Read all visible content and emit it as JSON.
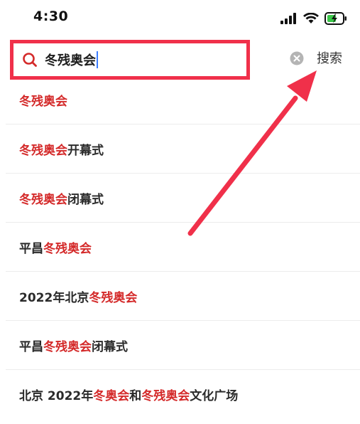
{
  "status_bar": {
    "time": "4:30"
  },
  "search": {
    "query": "冬残奥会",
    "search_label": "搜索"
  },
  "suggestions": [
    {
      "parts": [
        {
          "text": "冬残奥会",
          "hl": true
        }
      ]
    },
    {
      "parts": [
        {
          "text": "冬残奥会",
          "hl": true
        },
        {
          "text": "开幕式",
          "hl": false
        }
      ]
    },
    {
      "parts": [
        {
          "text": "冬残奥会",
          "hl": true
        },
        {
          "text": "闭幕式",
          "hl": false
        }
      ]
    },
    {
      "parts": [
        {
          "text": "平昌",
          "hl": false
        },
        {
          "text": "冬残奥会",
          "hl": true
        }
      ]
    },
    {
      "parts": [
        {
          "text": "2022年北京",
          "hl": false
        },
        {
          "text": "冬残奥会",
          "hl": true
        }
      ]
    },
    {
      "parts": [
        {
          "text": "平昌",
          "hl": false
        },
        {
          "text": "冬残奥会",
          "hl": true
        },
        {
          "text": "闭幕式",
          "hl": false
        }
      ]
    },
    {
      "parts": [
        {
          "text": "北京 2022年",
          "hl": false
        },
        {
          "text": "冬奥会",
          "hl": true
        },
        {
          "text": "和",
          "hl": false
        },
        {
          "text": "冬残奥会",
          "hl": true
        },
        {
          "text": "文化广场",
          "hl": false
        }
      ]
    }
  ],
  "colors": {
    "highlight": "#d42a2a",
    "annotation": "#f0304a",
    "caret": "#3b7cff"
  },
  "icons": [
    "cellular-signal-icon",
    "wifi-icon",
    "battery-charging-icon",
    "search-icon",
    "clear-icon"
  ]
}
